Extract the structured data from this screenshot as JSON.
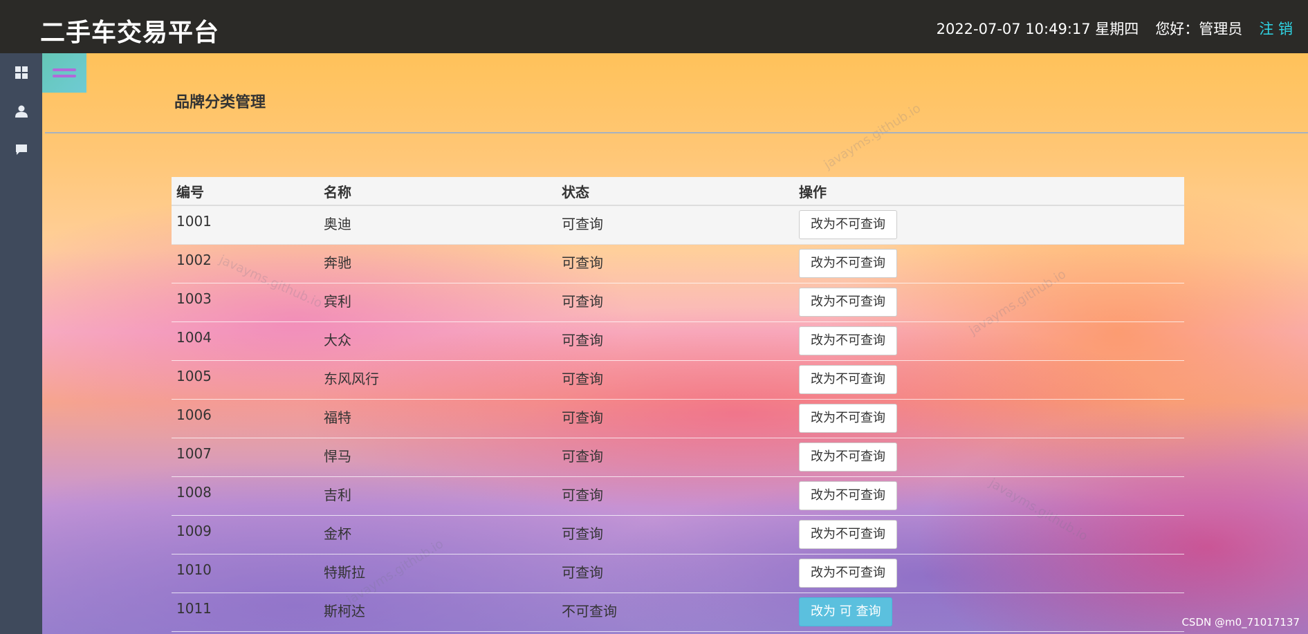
{
  "header": {
    "logo": "二手车交易平台",
    "datetime": "2022-07-07 10:49:17 星期四",
    "greeting": "您好：管理员",
    "logout": "注 销"
  },
  "sidebar": {
    "items": [
      {
        "icon": "dashboard-grid-icon"
      },
      {
        "icon": "user-icon"
      },
      {
        "icon": "comment-icon"
      }
    ]
  },
  "page": {
    "title": "品牌分类管理"
  },
  "table": {
    "columns": [
      "编号",
      "名称",
      "状态",
      "操作"
    ],
    "rows": [
      {
        "id": "1001",
        "name": "奥迪",
        "status": "可查询",
        "action": "改为不可查询"
      },
      {
        "id": "1002",
        "name": "奔驰",
        "status": "可查询",
        "action": "改为不可查询"
      },
      {
        "id": "1003",
        "name": "宾利",
        "status": "可查询",
        "action": "改为不可查询"
      },
      {
        "id": "1004",
        "name": "大众",
        "status": "可查询",
        "action": "改为不可查询"
      },
      {
        "id": "1005",
        "name": "东风风行",
        "status": "可查询",
        "action": "改为不可查询"
      },
      {
        "id": "1006",
        "name": "福特",
        "status": "可查询",
        "action": "改为不可查询"
      },
      {
        "id": "1007",
        "name": "悍马",
        "status": "可查询",
        "action": "改为不可查询"
      },
      {
        "id": "1008",
        "name": "吉利",
        "status": "可查询",
        "action": "改为不可查询"
      },
      {
        "id": "1009",
        "name": "金杯",
        "status": "可查询",
        "action": "改为不可查询"
      },
      {
        "id": "1010",
        "name": "特斯拉",
        "status": "可查询",
        "action": "改为不可查询"
      },
      {
        "id": "1011",
        "name": "斯柯达",
        "status": "不可查询",
        "action": "改为 可 查询"
      }
    ]
  },
  "watermark": "javayms.github.io",
  "footer_mark": "CSDN @m0_71017137",
  "colors": {
    "topbar": "#2b2a27",
    "sidebar": "#3f4a5c",
    "logout": "#2fd6e6",
    "button_info": "#5bc0de"
  }
}
